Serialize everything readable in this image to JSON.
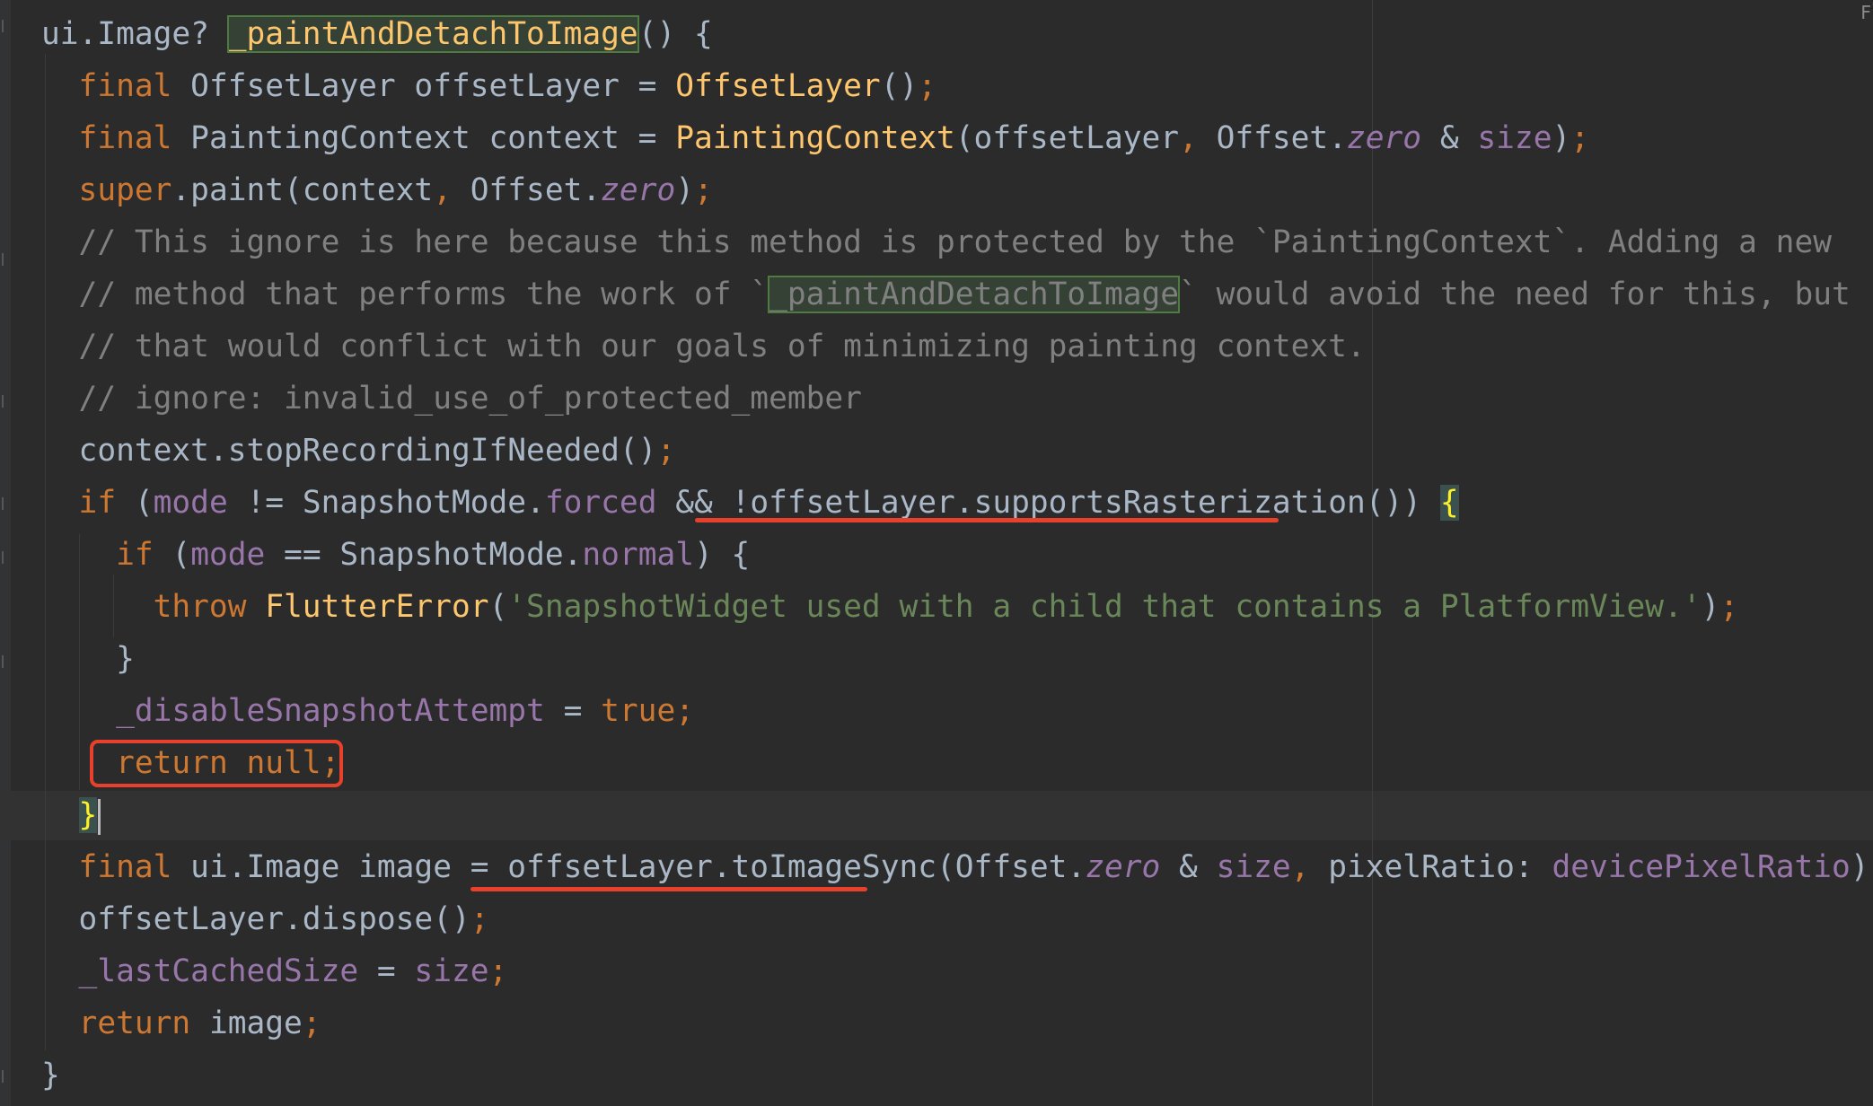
{
  "editor": {
    "corner_mark": "F",
    "lines": [
      {
        "indent": "",
        "tokens": [
          {
            "t": "ui.Image? ",
            "c": "plain"
          },
          {
            "t": "_paintAndDetachToImage",
            "c": "fn hl-name"
          },
          {
            "t": "() {",
            "c": "plain"
          }
        ]
      },
      {
        "indent": "  ",
        "tokens": [
          {
            "t": "final ",
            "c": "kw"
          },
          {
            "t": "OffsetLayer offsetLayer = ",
            "c": "plain"
          },
          {
            "t": "OffsetLayer",
            "c": "fn"
          },
          {
            "t": "()",
            "c": "plain"
          },
          {
            "t": ";",
            "c": "kw"
          }
        ]
      },
      {
        "indent": "  ",
        "tokens": [
          {
            "t": "final ",
            "c": "kw"
          },
          {
            "t": "PaintingContext context = ",
            "c": "plain"
          },
          {
            "t": "PaintingContext",
            "c": "fn"
          },
          {
            "t": "(offsetLayer",
            "c": "plain"
          },
          {
            "t": ", ",
            "c": "kw"
          },
          {
            "t": "Offset.",
            "c": "plain"
          },
          {
            "t": "zero",
            "c": "fld it"
          },
          {
            "t": " & ",
            "c": "plain"
          },
          {
            "t": "size",
            "c": "fld"
          },
          {
            "t": ")",
            "c": "plain"
          },
          {
            "t": ";",
            "c": "kw"
          }
        ]
      },
      {
        "indent": "  ",
        "tokens": [
          {
            "t": "super",
            "c": "kw"
          },
          {
            "t": ".paint(context",
            "c": "plain"
          },
          {
            "t": ", ",
            "c": "kw"
          },
          {
            "t": "Offset.",
            "c": "plain"
          },
          {
            "t": "zero",
            "c": "fld it"
          },
          {
            "t": ")",
            "c": "plain"
          },
          {
            "t": ";",
            "c": "kw"
          }
        ]
      },
      {
        "indent": "  ",
        "tokens": [
          {
            "t": "// This ignore is here because this method is protected by the `PaintingContext`. Adding a new",
            "c": "cm"
          }
        ]
      },
      {
        "indent": "  ",
        "tokens": [
          {
            "t": "// method that performs the work of `",
            "c": "cm"
          },
          {
            "t": "_paintAndDetachToImage",
            "c": "hl-cm"
          },
          {
            "t": "` would avoid the need for this, but",
            "c": "cm"
          }
        ]
      },
      {
        "indent": "  ",
        "tokens": [
          {
            "t": "// that would conflict with our goals of minimizing painting context.",
            "c": "cm"
          }
        ]
      },
      {
        "indent": "  ",
        "tokens": [
          {
            "t": "// ignore: invalid_use_of_protected_member",
            "c": "cm"
          }
        ]
      },
      {
        "indent": "  ",
        "tokens": [
          {
            "t": "context.stopRecordingIfNeeded()",
            "c": "plain"
          },
          {
            "t": ";",
            "c": "kw"
          }
        ]
      },
      {
        "indent": "  ",
        "tokens": [
          {
            "t": "if ",
            "c": "kw"
          },
          {
            "t": "(",
            "c": "plain"
          },
          {
            "t": "mode",
            "c": "fld"
          },
          {
            "t": " != SnapshotMode.",
            "c": "plain"
          },
          {
            "t": "forced",
            "c": "fld"
          },
          {
            "t": " && !offsetLayer.supportsRasterization()) ",
            "c": "plain"
          },
          {
            "t": "{",
            "c": "brace-hl"
          }
        ]
      },
      {
        "indent": "    ",
        "tokens": [
          {
            "t": "if ",
            "c": "kw"
          },
          {
            "t": "(",
            "c": "plain"
          },
          {
            "t": "mode",
            "c": "fld"
          },
          {
            "t": " == SnapshotMode.",
            "c": "plain"
          },
          {
            "t": "normal",
            "c": "fld"
          },
          {
            "t": ") {",
            "c": "plain"
          }
        ]
      },
      {
        "indent": "      ",
        "tokens": [
          {
            "t": "throw ",
            "c": "kw"
          },
          {
            "t": "FlutterError",
            "c": "fn"
          },
          {
            "t": "(",
            "c": "plain"
          },
          {
            "t": "'SnapshotWidget used with a child that contains a PlatformView.'",
            "c": "str"
          },
          {
            "t": ")",
            "c": "plain"
          },
          {
            "t": ";",
            "c": "kw"
          }
        ]
      },
      {
        "indent": "    ",
        "tokens": [
          {
            "t": "}",
            "c": "plain"
          }
        ]
      },
      {
        "indent": "    ",
        "tokens": [
          {
            "t": "_disableSnapshotAttempt",
            "c": "fld"
          },
          {
            "t": " = ",
            "c": "plain"
          },
          {
            "t": "true",
            "c": "kw"
          },
          {
            "t": ";",
            "c": "kw"
          }
        ]
      },
      {
        "indent": "    ",
        "tokens": [
          {
            "t": "return null",
            "c": "kw"
          },
          {
            "t": ";",
            "c": "kw"
          }
        ]
      },
      {
        "indent": "  ",
        "tokens": [
          {
            "t": "}",
            "c": "brace-hl"
          }
        ],
        "caret": true
      },
      {
        "indent": "  ",
        "tokens": [
          {
            "t": "final ",
            "c": "kw"
          },
          {
            "t": "ui.Image image = offsetLayer.toImageSync(Offset.",
            "c": "plain"
          },
          {
            "t": "zero",
            "c": "fld it"
          },
          {
            "t": " & ",
            "c": "plain"
          },
          {
            "t": "size",
            "c": "fld"
          },
          {
            "t": ", ",
            "c": "kw"
          },
          {
            "t": "pixelRatio: ",
            "c": "plain"
          },
          {
            "t": "devicePixelRatio",
            "c": "fld"
          },
          {
            "t": ")",
            "c": "plain"
          },
          {
            "t": ";",
            "c": "kw"
          }
        ]
      },
      {
        "indent": "  ",
        "tokens": [
          {
            "t": "offsetLayer.dispose()",
            "c": "plain"
          },
          {
            "t": ";",
            "c": "kw"
          }
        ]
      },
      {
        "indent": "  ",
        "tokens": [
          {
            "t": "_lastCachedSize",
            "c": "fld"
          },
          {
            "t": " = ",
            "c": "plain"
          },
          {
            "t": "size",
            "c": "fld"
          },
          {
            "t": ";",
            "c": "kw"
          }
        ]
      },
      {
        "indent": "  ",
        "tokens": [
          {
            "t": "return ",
            "c": "kw"
          },
          {
            "t": "image",
            "c": "plain"
          },
          {
            "t": ";",
            "c": "kw"
          }
        ]
      },
      {
        "indent": "",
        "tokens": [
          {
            "t": "}",
            "c": "plain"
          }
        ]
      }
    ],
    "annotations": {
      "underline_1": "offsetLayer.supportsRasterization()",
      "underline_2": "offsetLayer.toImageSync",
      "boxed_statement": "return null;"
    },
    "colors": {
      "background": "#2b2b2b",
      "keyword": "#cc7832",
      "function": "#ffc66d",
      "field": "#9876aa",
      "comment": "#808080",
      "string": "#6a8759",
      "plain": "#a9b7c6",
      "annotation_red": "#e8412b"
    }
  }
}
